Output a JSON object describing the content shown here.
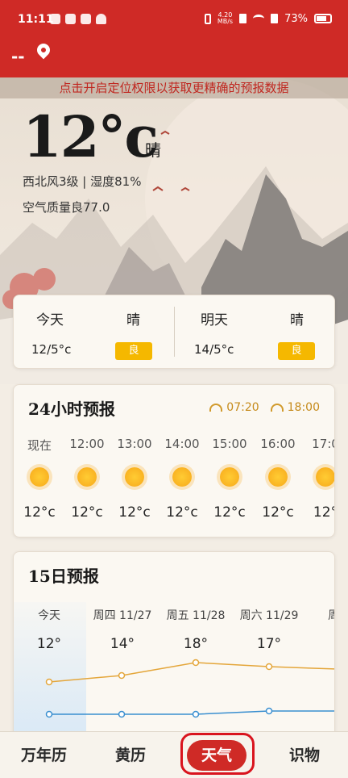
{
  "status_bar": {
    "time": "11:11",
    "net_speed_top": "4.20",
    "net_speed_bottom": "MB/s",
    "battery": "73%"
  },
  "header": {
    "location": "--",
    "location_icon": "map-pin-icon"
  },
  "permission_banner": "点击开启定位权限以获取更精确的预报数据",
  "current": {
    "temperature": "12°c",
    "condition": "晴",
    "wind_humidity": "西北风3级  |  湿度81%",
    "air_quality": "空气质量良77.0"
  },
  "summary": {
    "today": {
      "label": "今天",
      "condition": "晴",
      "range": "12/5°c",
      "aqi": "良"
    },
    "tomorrow": {
      "label": "明天",
      "condition": "晴",
      "range": "14/5°c",
      "aqi": "良"
    },
    "badge_color": "#f5b800"
  },
  "hourly": {
    "title": "24小时预报",
    "sunrise": "07:20",
    "sunset": "18:00",
    "hours": [
      {
        "time": "现在",
        "temp": "12°c",
        "icon": "sun-icon"
      },
      {
        "time": "12:00",
        "temp": "12°c",
        "icon": "sun-icon"
      },
      {
        "time": "13:00",
        "temp": "12°c",
        "icon": "sun-icon"
      },
      {
        "time": "14:00",
        "temp": "12°c",
        "icon": "sun-icon"
      },
      {
        "time": "15:00",
        "temp": "12°c",
        "icon": "sun-icon"
      },
      {
        "time": "16:00",
        "temp": "12°c",
        "icon": "sun-icon"
      },
      {
        "time": "17:0",
        "temp": "12°",
        "icon": "sun-icon"
      }
    ]
  },
  "daily": {
    "title": "15日预报",
    "days": [
      {
        "label": "今天",
        "high": "12°"
      },
      {
        "label": "周四 11/27",
        "high": "14°"
      },
      {
        "label": "周五 11/28",
        "high": "18°"
      },
      {
        "label": "周六 11/29",
        "high": "17°"
      },
      {
        "label": "周日",
        "high": ""
      }
    ],
    "high_line_color": "#e4a63a",
    "low_line_color": "#3a8fd0"
  },
  "tabs": {
    "calendar": "万年历",
    "almanac": "黄历",
    "weather": "天气",
    "identify": "识物"
  },
  "accent_color": "#cf2a26"
}
